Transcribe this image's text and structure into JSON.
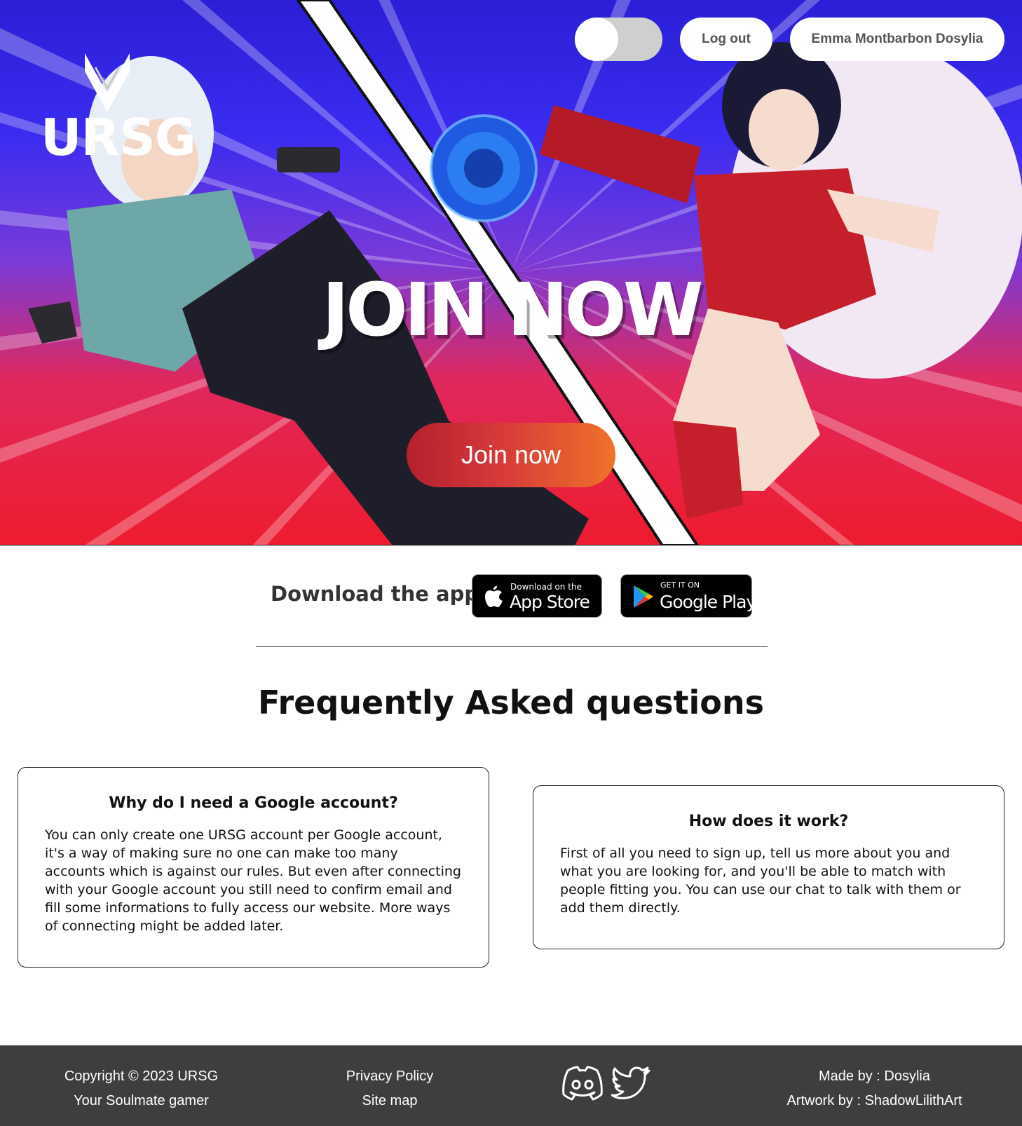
{
  "header": {
    "brand": "URSG",
    "theme_toggle_icon": "toggle-switch",
    "logout_label": "Log out",
    "profile_label": "Emma Montbarbon Dosylia"
  },
  "hero": {
    "title": "JOIN NOW",
    "cta_label": "Join now",
    "colors": {
      "top": "#2a1fd6",
      "middle": "#7a3ad8",
      "bottom": "#ee1c2e",
      "cta_start": "#b5202e",
      "cta_end": "#f0722a"
    }
  },
  "download": {
    "label": "Download the app",
    "app_store": {
      "small": "Download on the",
      "big": "App Store",
      "icon": "apple-icon"
    },
    "google_play": {
      "small": "GET IT ON",
      "big": "Google Play",
      "icon": "google-play-icon"
    }
  },
  "faq": {
    "title": "Frequently Asked questions",
    "items": [
      {
        "question": "Why do I need a Google account?",
        "answer": "You can only create one URSG account per Google account, it's a way of making sure no one can make too many accounts which is against our rules. But even after connecting with your Google account you still need to confirm email and fill some informations to fully access our website. More ways of connecting might be added later."
      },
      {
        "question": "How does it work?",
        "answer": "First of all you need to sign up, tell us more about you and what you are looking for, and you'll be able to match with people fitting you. You can use our chat to talk with them or add them directly."
      }
    ]
  },
  "footer": {
    "copyright": "Copyright © 2023 URSG",
    "tagline": "Your Soulmate gamer",
    "privacy_label": "Privacy Policy",
    "sitemap_label": "Site map",
    "social": [
      "discord-icon",
      "twitter-icon"
    ],
    "made_by": "Made by : Dosylia",
    "artwork_by": "Artwork by : ShadowLilithArt",
    "background": "#3f3e3e"
  }
}
